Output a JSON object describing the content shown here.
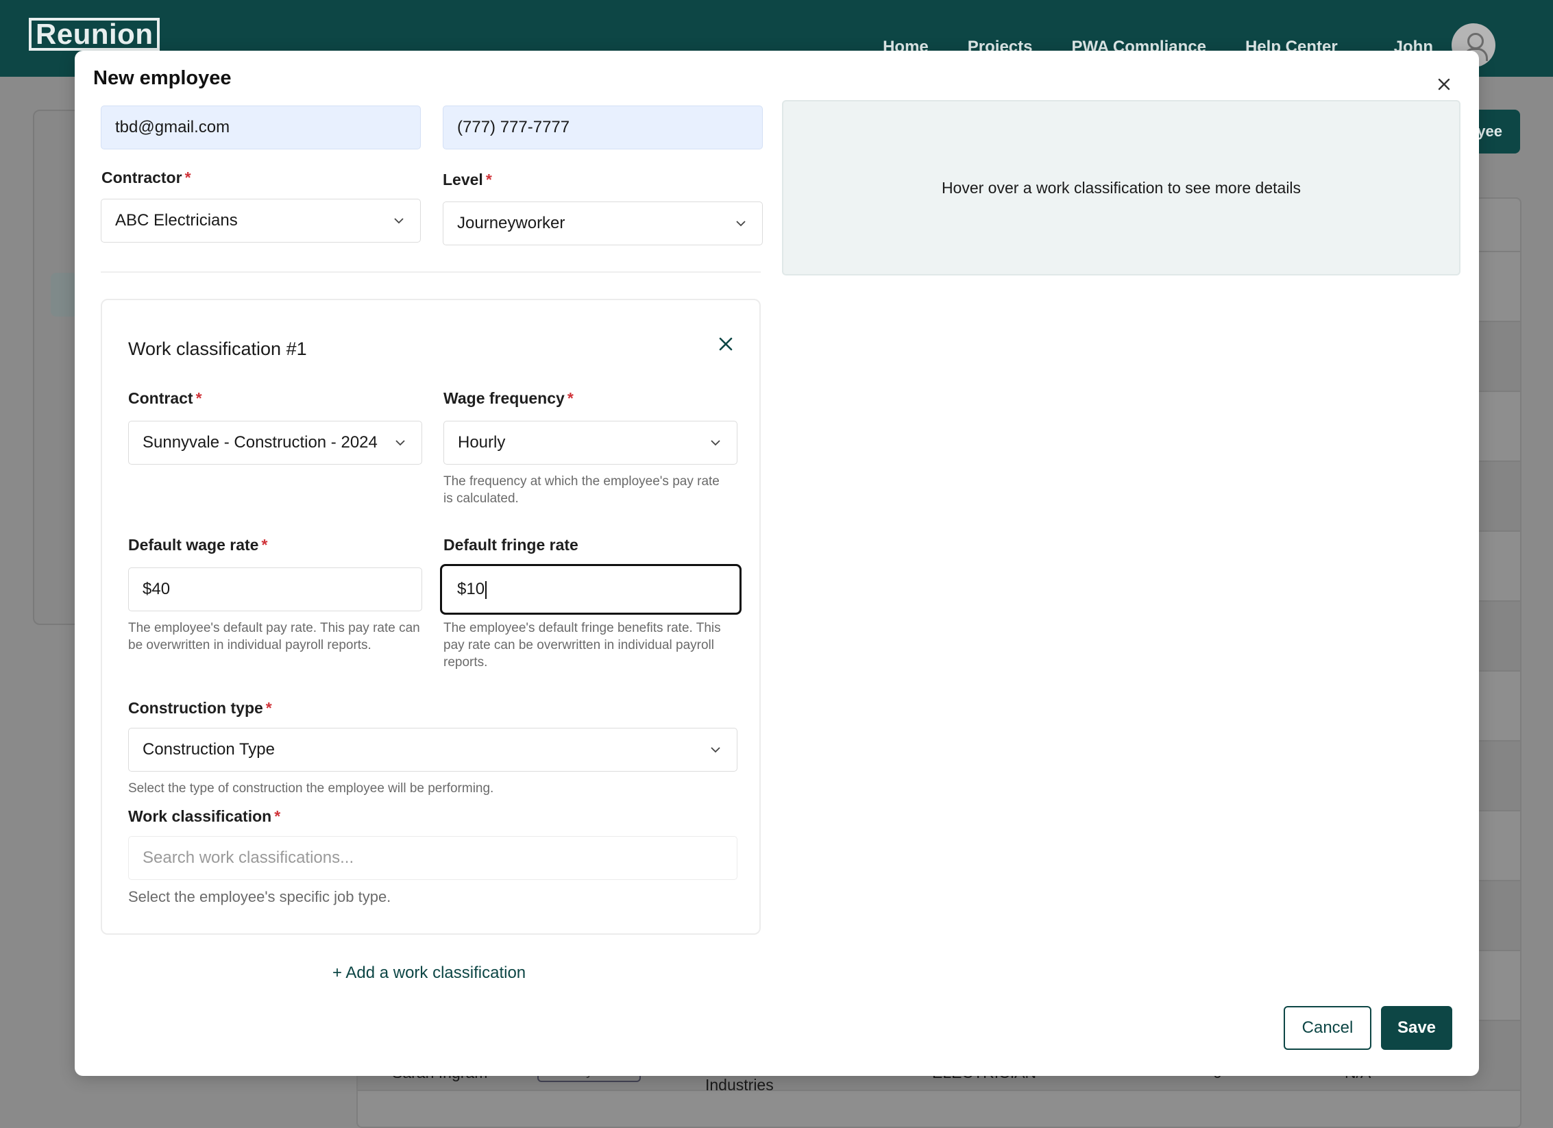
{
  "app": {
    "logo": "Reunion",
    "nav": [
      "Home",
      "Projects",
      "PWA Compliance",
      "Help Center"
    ],
    "user_name": "John",
    "bg_button_label": "yee",
    "bg_row": {
      "name": "Sarah Ingram",
      "level": "Journeyworker",
      "contractor": "Industries",
      "classification": "ELECTRICIAN",
      "count": "0",
      "na": "N/A"
    }
  },
  "modal": {
    "title": "New employee",
    "email_value": "tbd@gmail.com",
    "phone_value": "(777) 777-7777",
    "contractor_label": "Contractor",
    "contractor_value": "ABC Electricians",
    "level_label": "Level",
    "level_value": "Journeyworker",
    "required_mark": "*",
    "info_text": "Hover over a work classification to see more details",
    "classification": {
      "title": "Work classification #1",
      "contract_label": "Contract",
      "contract_value": "Sunnyvale - Construction - 2024",
      "wage_frequency_label": "Wage frequency",
      "wage_frequency_value": "Hourly",
      "wage_frequency_help": "The frequency at which the employee's pay rate is calculated.",
      "default_wage_label": "Default wage rate",
      "default_wage_value": "$40",
      "default_wage_help": "The employee's default pay rate. This pay rate can be overwritten in individual payroll reports.",
      "default_fringe_label": "Default fringe rate",
      "default_fringe_value": "$10",
      "default_fringe_help": "The employee's default fringe benefits rate. This pay rate can be overwritten in individual payroll reports.",
      "construction_type_label": "Construction type",
      "construction_type_value": "Construction Type",
      "construction_type_help": "Select the type of construction the employee will be performing.",
      "work_classification_label": "Work classification",
      "work_classification_placeholder": "Search work classifications...",
      "work_classification_help": "Select the employee's specific job type."
    },
    "add_classification_label": "+ Add a work classification",
    "cancel_label": "Cancel",
    "save_label": "Save"
  }
}
